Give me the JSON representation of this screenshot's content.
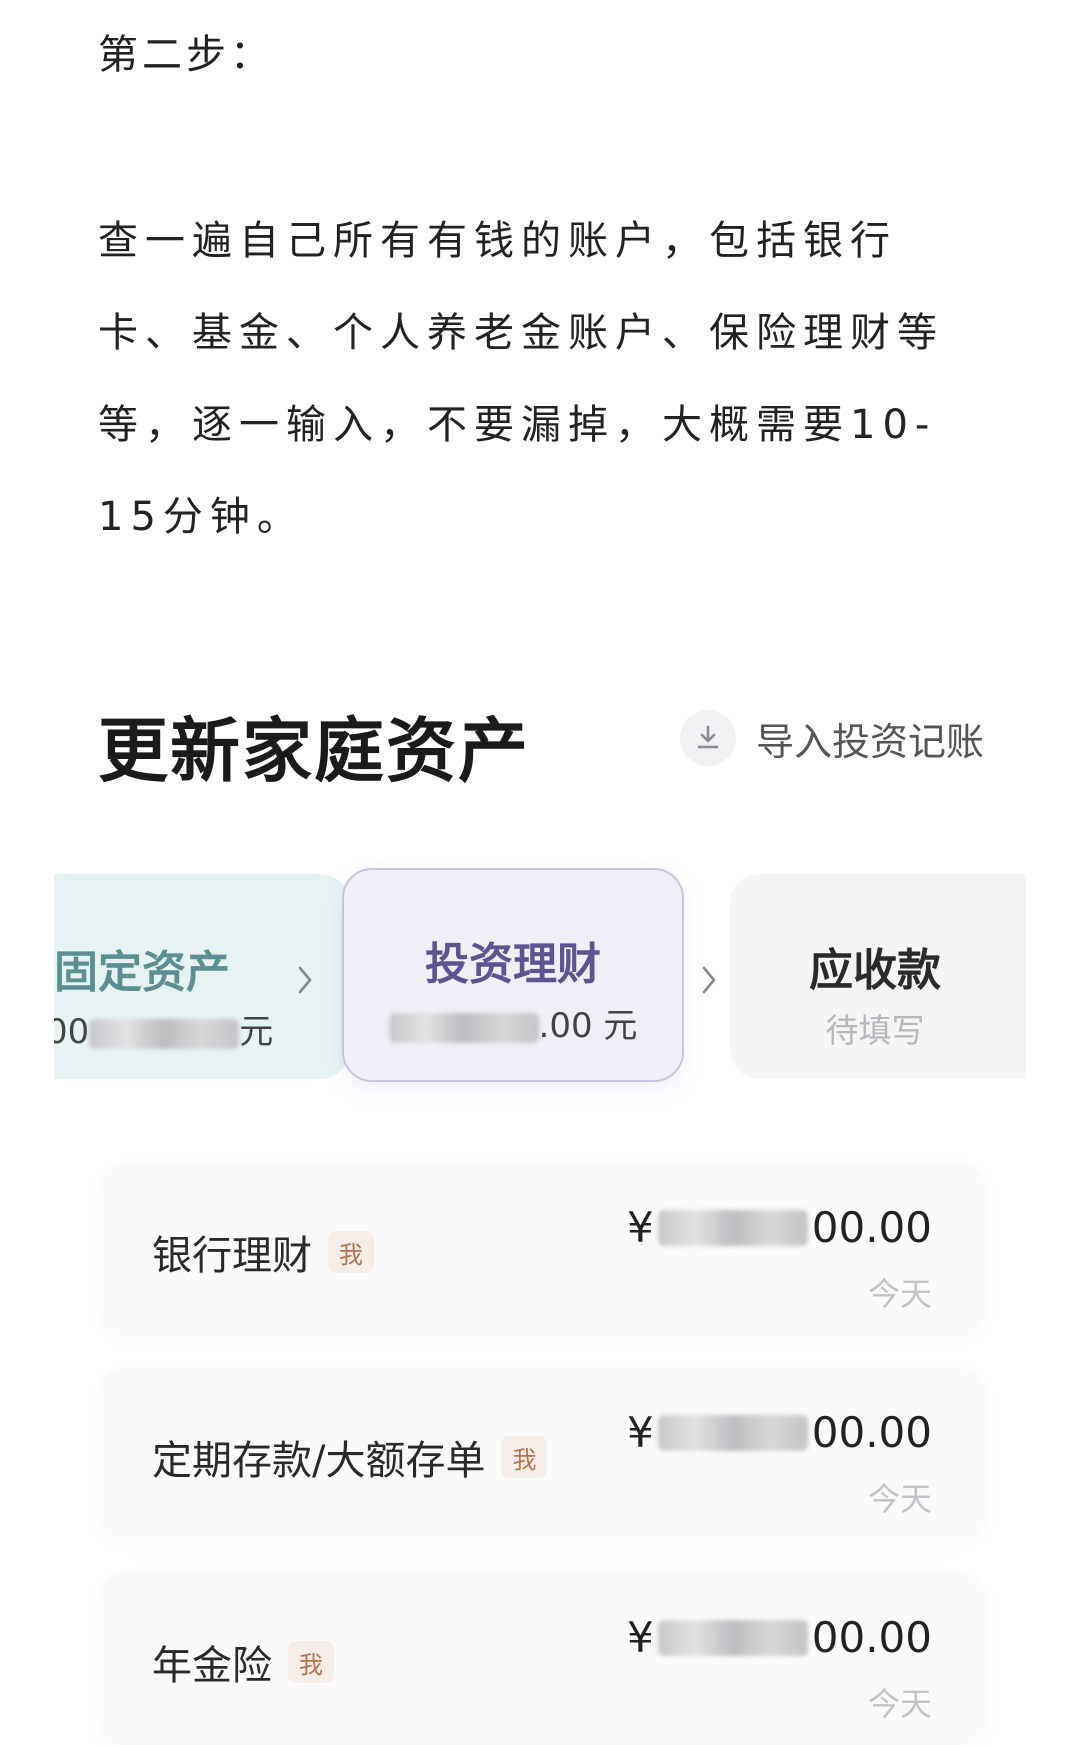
{
  "article": {
    "step_title": "第二步：",
    "paragraph_lines": [
      "查一遍自己所有有钱的账户，包括银行",
      "卡、基金、个人养老金账户、保险理财等",
      "等，逐一输入，不要漏掉，大概需要10-",
      "15分钟。"
    ]
  },
  "header": {
    "title": "更新家庭资产",
    "import_label": "导入投资记账",
    "import_icon": "download-icon"
  },
  "categories": [
    {
      "name": "固定资产",
      "value_prefix": "00",
      "value_suffix": "元",
      "selected": false
    },
    {
      "name": "投资理财",
      "value_prefix": "",
      "value_suffix": ".00 元",
      "selected": true
    },
    {
      "name": "应收款",
      "value_text": "待填写",
      "selected": false
    }
  ],
  "accounts": [
    {
      "name": "银行理财",
      "badge": "我",
      "currency": "¥",
      "amount_suffix": "00.00",
      "date": "今天"
    },
    {
      "name": "定期存款/大额存单",
      "badge": "我",
      "currency": "¥",
      "amount_suffix": "00.00",
      "date": "今天"
    },
    {
      "name": "年金险",
      "badge": "我",
      "currency": "¥",
      "amount_suffix": "00.00",
      "date": "今天"
    }
  ],
  "colors": {
    "fixed_card_bg": "#e7f3f3",
    "invest_card_bg": "#f0eff8",
    "invest_card_text": "#5e5490",
    "badge_bg": "#f7ede8",
    "badge_text": "#b5734f"
  }
}
